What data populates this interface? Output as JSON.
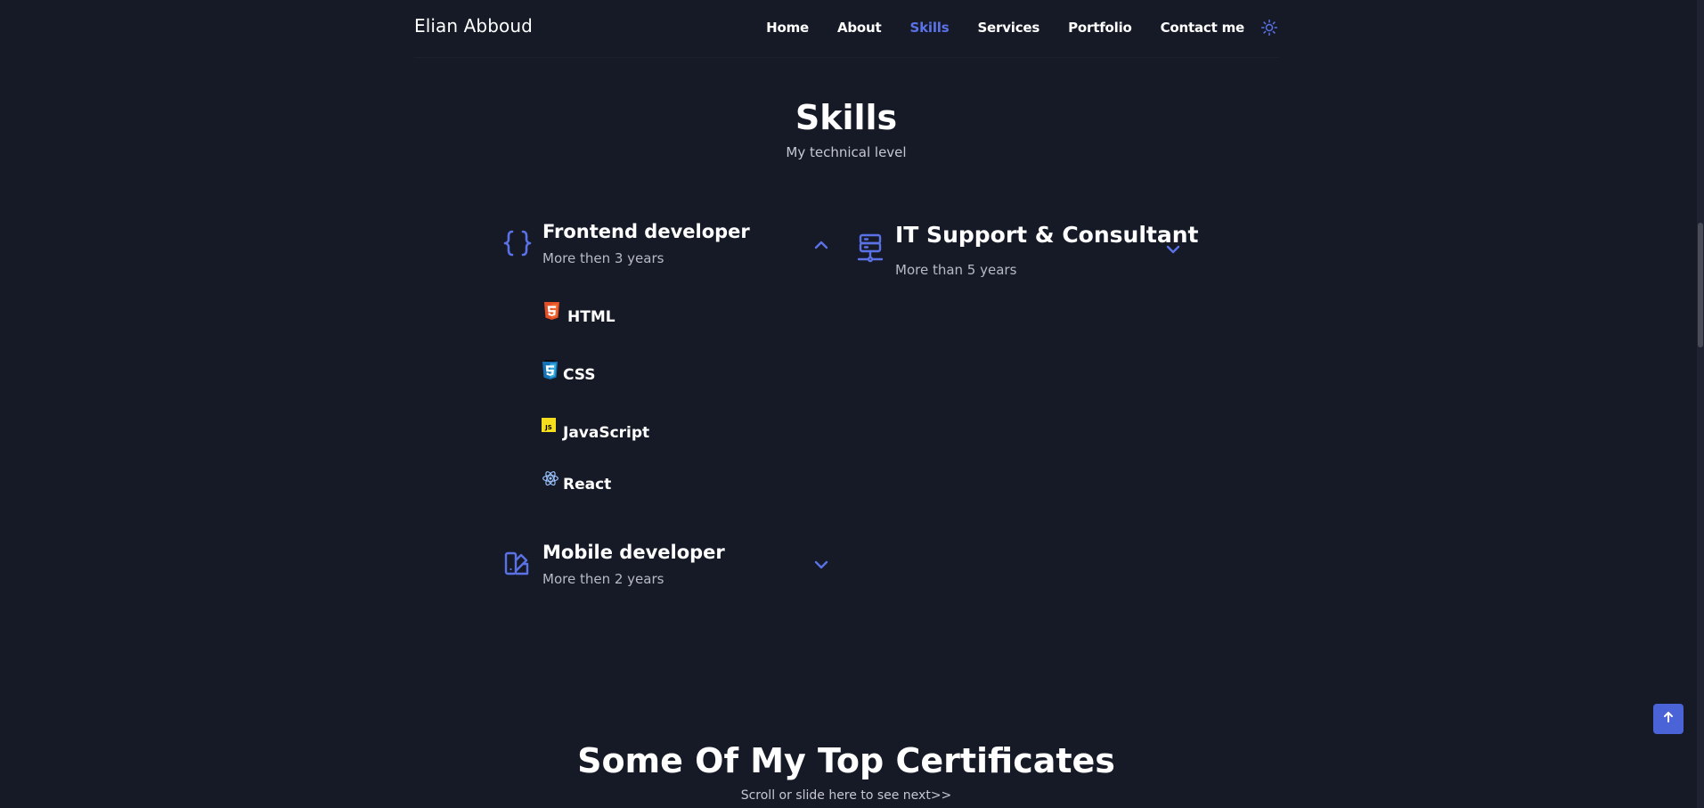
{
  "header": {
    "logo": "Elian Abboud",
    "nav": [
      {
        "label": "Home"
      },
      {
        "label": "About"
      },
      {
        "label": "Skills"
      },
      {
        "label": "Services"
      },
      {
        "label": "Portfolio"
      },
      {
        "label": "Contact me"
      }
    ],
    "active_nav": "Skills"
  },
  "skills": {
    "title": "Skills",
    "subtitle": "My technical level",
    "groups": [
      {
        "title": "Frontend developer",
        "subtitle": "More then 3 years",
        "icon": "braces-icon",
        "expanded": true,
        "items": [
          {
            "name": "HTML",
            "icon": "html5-icon"
          },
          {
            "name": "CSS",
            "icon": "css3-icon"
          },
          {
            "name": "JavaScript",
            "icon": "javascript-icon"
          },
          {
            "name": "React",
            "icon": "react-icon"
          }
        ]
      },
      {
        "title": "IT Support & Consultant",
        "subtitle": "More than 5 years",
        "icon": "server-network-icon",
        "expanded": false
      },
      {
        "title": "Mobile developer",
        "subtitle": "More then 2 years",
        "icon": "mobile-palette-icon",
        "expanded": false
      }
    ]
  },
  "certificates": {
    "title": "Some Of My Top Certificates",
    "subtitle": "Scroll or slide here to see next>>"
  },
  "colors": {
    "background": "#161a27",
    "accent": "#5b72e6",
    "text": "#ffffff",
    "muted": "#b7bac5"
  }
}
